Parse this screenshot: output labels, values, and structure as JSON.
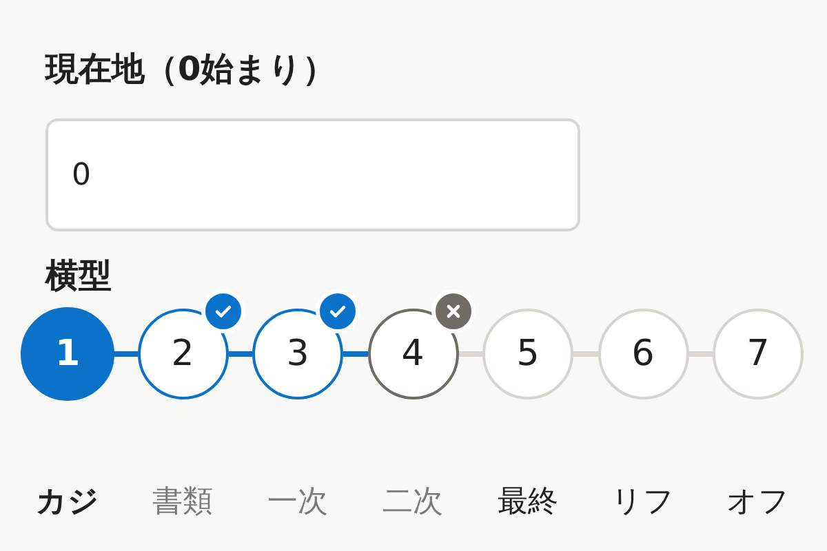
{
  "position_field": {
    "label": "現在地（0始まり）",
    "value": "0"
  },
  "stepper": {
    "title": "横型",
    "steps": [
      {
        "number": "1",
        "label": "カジ",
        "current": true,
        "completed": false,
        "rejected": false
      },
      {
        "number": "2",
        "label": "書類",
        "current": false,
        "completed": true,
        "rejected": false
      },
      {
        "number": "3",
        "label": "一次",
        "current": false,
        "completed": true,
        "rejected": false
      },
      {
        "number": "4",
        "label": "二次",
        "current": false,
        "completed": false,
        "rejected": true
      },
      {
        "number": "5",
        "label": "最終",
        "current": false,
        "completed": false,
        "rejected": false
      },
      {
        "number": "6",
        "label": "リフ",
        "current": false,
        "completed": false,
        "rejected": false
      },
      {
        "number": "7",
        "label": "オフ",
        "current": false,
        "completed": false,
        "rejected": false
      }
    ]
  }
}
